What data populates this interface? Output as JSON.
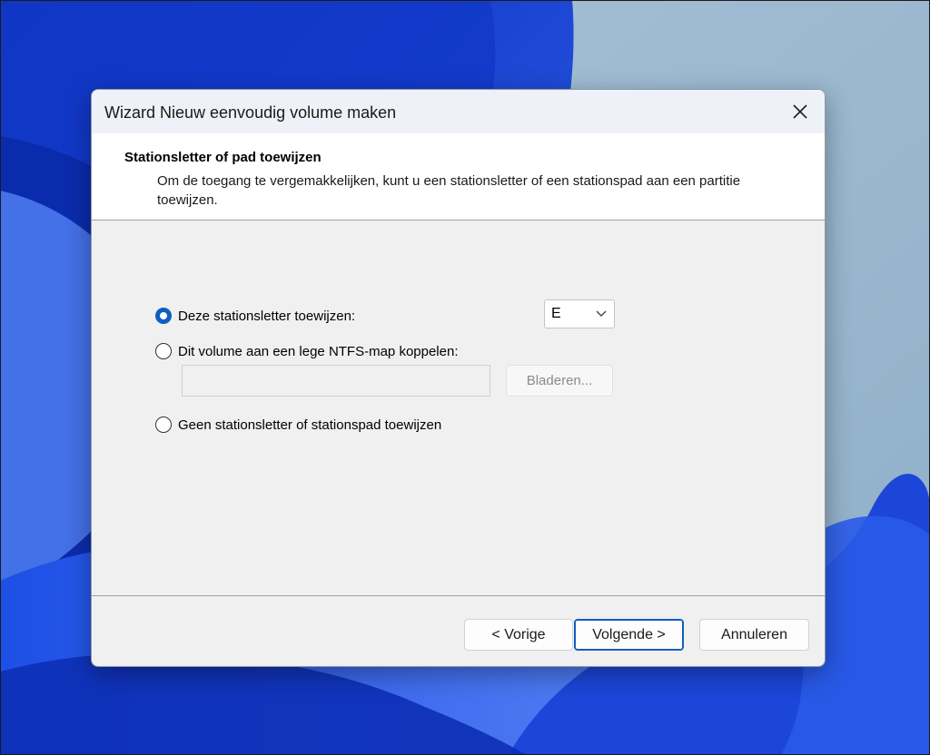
{
  "window": {
    "title": "Wizard Nieuw eenvoudig volume maken"
  },
  "header": {
    "title": "Stationsletter of pad toewijzen",
    "description": "Om de toegang te vergemakkelijken, kunt u een stationsletter of een stationspad aan een partitie toewijzen."
  },
  "options": {
    "assign_letter": {
      "label": "Deze stationsletter toewijzen:",
      "checked": true
    },
    "mount_folder": {
      "label": "Dit volume aan een lege NTFS-map koppelen:",
      "checked": false
    },
    "no_letter": {
      "label": "Geen stationsletter of stationspad toewijzen",
      "checked": false
    }
  },
  "drive_letter": {
    "selected": "E"
  },
  "folder_path": {
    "value": ""
  },
  "browse_label": "Bladeren...",
  "buttons": {
    "back": "< Vorige",
    "next": "Volgende >",
    "cancel": "Annuleren"
  },
  "icons": {
    "close": "close-icon",
    "dropdown": "chevron-down-icon"
  },
  "colors": {
    "accent": "#0f5ec2",
    "wallpaper_blue": "#1840d8",
    "wallpaper_sky": "#9bb8d0"
  }
}
